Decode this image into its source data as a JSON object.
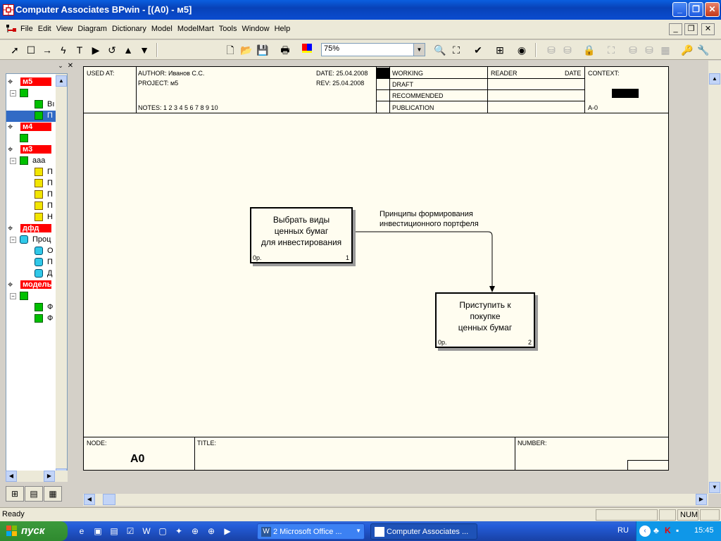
{
  "window": {
    "title": "Computer Associates BPwin - [(A0)  - м5]",
    "controls": {
      "minimize": "_",
      "maximize": "❐",
      "close": "✕"
    }
  },
  "menu": [
    "File",
    "Edit",
    "View",
    "Diagram",
    "Dictionary",
    "Model",
    "ModelMart",
    "Tools",
    "Window",
    "Help"
  ],
  "toolbar": {
    "zoom_value": "75%"
  },
  "explorer": {
    "models": [
      {
        "label": "м5",
        "children": [
          {
            "label": "",
            "children": [
              "Вı",
              "П"
            ]
          }
        ]
      },
      {
        "label": "м4",
        "children": [
          {
            "label": ""
          }
        ]
      },
      {
        "label": "м3",
        "children": [
          {
            "label": "aaa",
            "children": [
              "П",
              "П",
              "П",
              "П",
              "Н"
            ]
          }
        ]
      },
      {
        "label": "дфд",
        "children": [
          {
            "label": "Проц",
            "children": [
              "О",
              "П",
              "Д"
            ]
          }
        ]
      },
      {
        "label": "модель",
        "children": [
          {
            "label": "",
            "children": [
              "Ф",
              "Ф"
            ]
          }
        ]
      }
    ]
  },
  "frame": {
    "used_at": "USED AT:",
    "author": "AUTHOR:  Иванов С.С.",
    "project": "PROJECT:  м5",
    "date": "DATE: 25.04.2008",
    "rev": "REV:   25.04.2008",
    "notes": "NOTES:  1  2  3  4  5  6  7  8  9  10",
    "status": [
      "WORKING",
      "DRAFT",
      "RECOMMENDED",
      "PUBLICATION"
    ],
    "reader": "READER",
    "reader_date": "DATE",
    "context": "CONTEXT:",
    "context_node": "A-0",
    "node_label": "NODE:",
    "node_value": "A0",
    "title_label": "TITLE:",
    "number_label": "NUMBER:"
  },
  "diagram": {
    "box1": {
      "text": [
        "Выбрать виды",
        "ценных бумаг",
        "для инвестирования"
      ],
      "op": "0р.",
      "num": "1"
    },
    "box2": {
      "text": [
        "Приступить к",
        "покупке",
        "ценных бумаг"
      ],
      "op": "0р.",
      "num": "2"
    },
    "arrow_label": [
      "Принципы формирования",
      "инвестиционного портфеля"
    ]
  },
  "status": {
    "text": "Ready",
    "num": "NUM"
  },
  "taskbar": {
    "start": "пуск",
    "tasks": [
      {
        "label": "2 Microsoft Office ...",
        "active": false
      },
      {
        "label": "Computer Associates ...",
        "active": true
      }
    ],
    "lang": "RU",
    "time": "15:45"
  }
}
